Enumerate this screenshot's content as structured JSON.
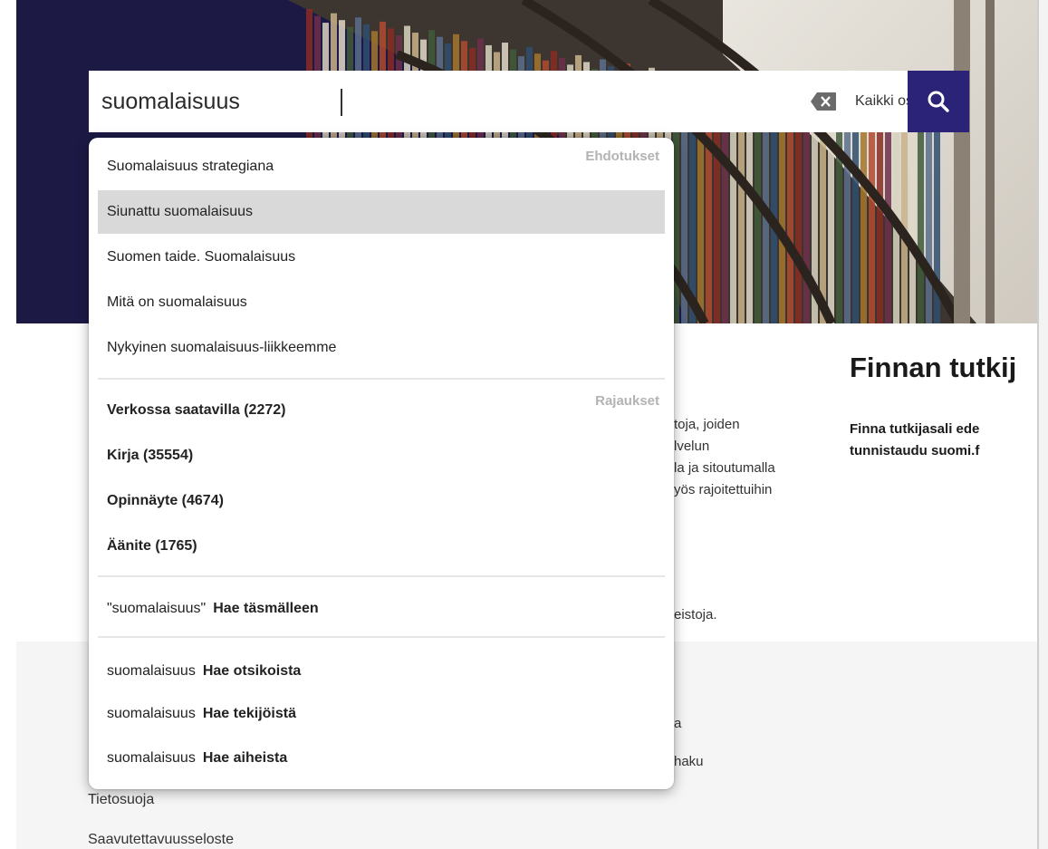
{
  "search": {
    "value": "suomalaisuus",
    "scope_label": "Kaikki osumat",
    "icons": {
      "clear": "backspace-clear-icon",
      "submit": "magnifier-search-icon",
      "scope": "chevron-down-icon"
    }
  },
  "suggestions": {
    "label": "Ehdotukset",
    "items": [
      "Suomalaisuus strategiana",
      "Siunattu suomalaisuus",
      "Suomen taide. Suomalaisuus",
      "Mitä on suomalaisuus",
      "Nykyinen suomalaisuus-liikkeemme"
    ],
    "selected_index": 1
  },
  "filters": {
    "label": "Rajaukset",
    "items": [
      "Verkossa saatavilla (2272)",
      "Kirja (35554)",
      "Opinnäyte (4674)",
      "Äänite (1765)"
    ]
  },
  "exact": {
    "keyword": "\"suomalaisuus\"",
    "action": "Hae täsmälleen"
  },
  "field_searches": [
    {
      "keyword": "suomalaisuus",
      "action": "Hae otsikoista"
    },
    {
      "keyword": "suomalaisuus",
      "action": "Hae tekijöistä"
    },
    {
      "keyword": "suomalaisuus",
      "action": "Hae aiheista"
    }
  ],
  "page": {
    "section_title": "Finnan tutkij",
    "tutkija_line1": "Finna tutkijasali ede",
    "tutkija_line2": "tunnistaudu suomi.f",
    "body_fragments": [
      "toja, joiden",
      "lvelun",
      "la ja sitoutumalla",
      "yös rajoitettuihin",
      "eistoja."
    ],
    "footer_fragments": [
      "a",
      "haku"
    ],
    "footer_links": [
      "Tietosuoja",
      "Saavutettavuusseloste"
    ]
  },
  "colors": {
    "brand": "#2b2377",
    "hero_bg": "#1c1a45",
    "selected": "#d9d9d9"
  }
}
